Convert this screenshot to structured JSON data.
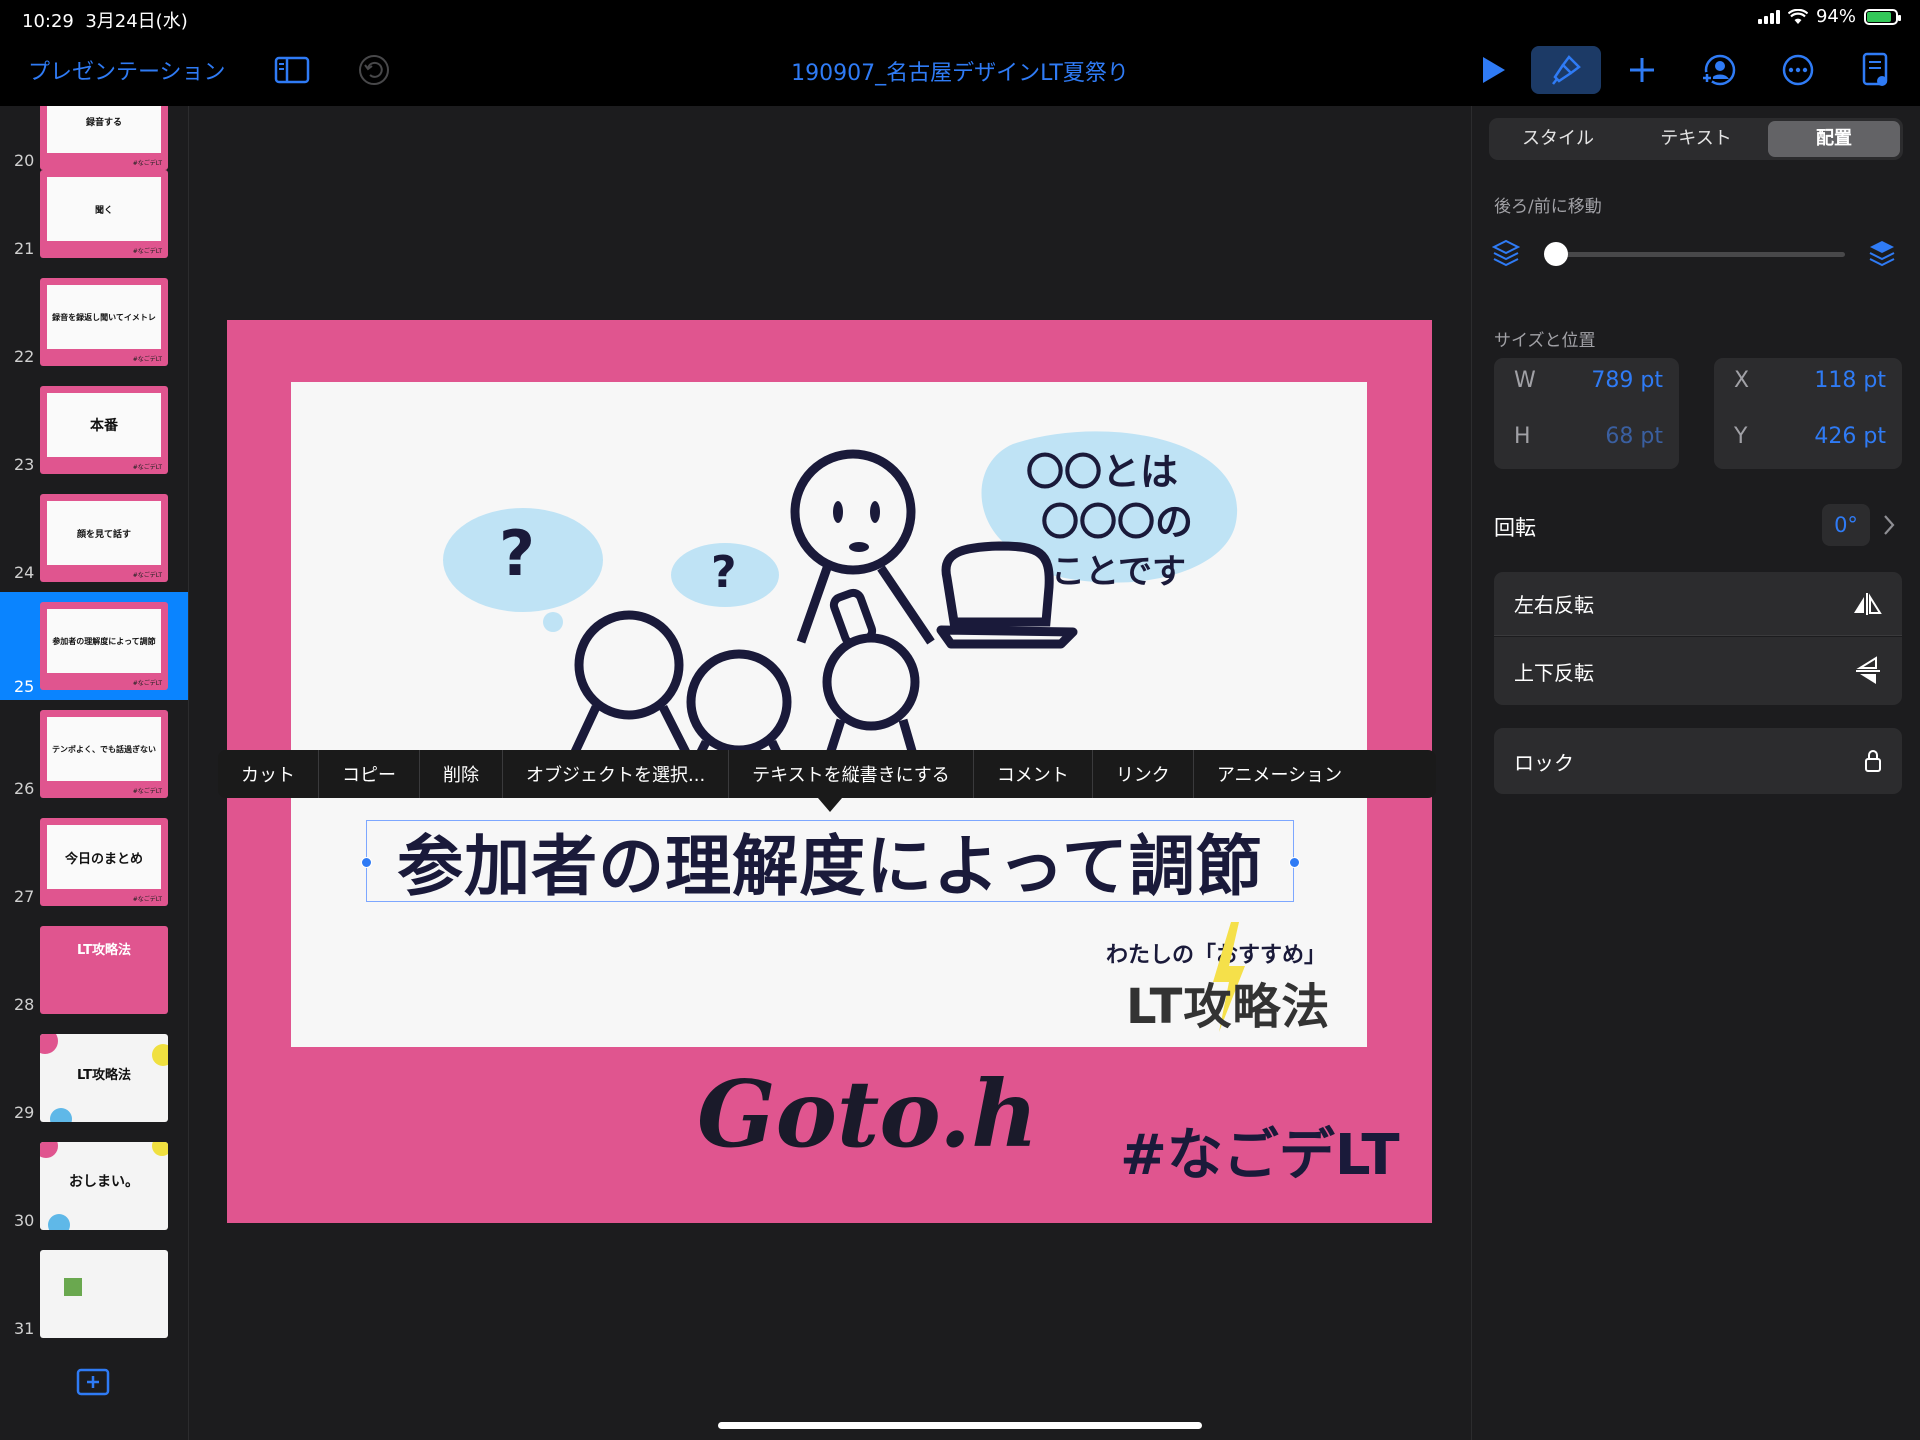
{
  "status": {
    "time": "10:29",
    "date": "3月24日(水)",
    "battery": "94%",
    "battery_level": 0.94
  },
  "toolbar": {
    "back_label": "プレゼンテーション",
    "title": "190907_名古屋デザインLT夏祭り"
  },
  "slides": [
    {
      "num": "20",
      "text": "録音する"
    },
    {
      "num": "21",
      "text": "聞く"
    },
    {
      "num": "22",
      "text": "録音を録返し聞いてイメトレ"
    },
    {
      "num": "23",
      "text": "本番"
    },
    {
      "num": "24",
      "text": "顔を見て話す"
    },
    {
      "num": "25",
      "text": "参加者の理解度によって調節"
    },
    {
      "num": "26",
      "text": "テンポよく、でも話過ぎない"
    },
    {
      "num": "27",
      "text": "今日のまとめ"
    },
    {
      "num": "28",
      "text": "LT攻略法"
    },
    {
      "num": "29",
      "text": "LT攻略法"
    },
    {
      "num": "30",
      "text": "おしまい。"
    },
    {
      "num": "31",
      "text": ""
    }
  ],
  "slide": {
    "headline": "参加者の理解度によって調節",
    "bubble_lines": [
      "〇〇とは",
      "〇〇〇の",
      "ことです"
    ],
    "question": "?",
    "sub_label": "わたしの「おすすめ」",
    "sub_title": "LT攻略法",
    "logo": "Goto.h",
    "hashtag": "#なごデLT"
  },
  "context_menu": [
    "カット",
    "コピー",
    "削除",
    "オブジェクトを選択...",
    "テキストを縦書きにする",
    "コメント",
    "リンク",
    "アニメーション"
  ],
  "panel": {
    "tabs": [
      "スタイル",
      "テキスト",
      "配置"
    ],
    "layer_label": "後ろ/前に移動",
    "size_label": "サイズと位置",
    "w_label": "W",
    "w": "789 pt",
    "h_label": "H",
    "h": "68 pt",
    "x_label": "X",
    "x": "118 pt",
    "y_label": "Y",
    "y": "426 pt",
    "rotation_label": "回転",
    "rotation": "0°",
    "flip_h": "左右反転",
    "flip_v": "上下反転",
    "lock": "ロック"
  },
  "colors": {
    "accent": "#2f7bf5",
    "slide_pink": "#e0558f",
    "bubble": "#bfe3f5"
  }
}
